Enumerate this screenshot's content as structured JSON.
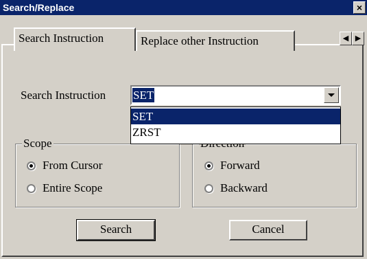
{
  "window": {
    "title": "Search/Replace",
    "close_glyph": "×"
  },
  "tabs": [
    {
      "label": "Search Instruction",
      "active": true
    },
    {
      "label": "Replace other Instruction",
      "active": false
    }
  ],
  "tab_scroll": {
    "left_icon": "left-arrow-icon",
    "right_icon": "right-arrow-icon"
  },
  "search": {
    "label": "Search Instruction",
    "value": "SET",
    "options": [
      "SET",
      "ZRST"
    ],
    "selected_index": 0
  },
  "scope": {
    "label": "Scope",
    "options": [
      {
        "label": "From Cursor",
        "checked": true
      },
      {
        "label": "Entire Scope",
        "checked": false
      }
    ]
  },
  "direction": {
    "label": "Direction",
    "options": [
      {
        "label": "Forward",
        "checked": true
      },
      {
        "label": "Backward",
        "checked": false
      }
    ]
  },
  "buttons": {
    "search": "Search",
    "cancel": "Cancel"
  },
  "colors": {
    "titlebar": "#0a246a",
    "face": "#d4d0c8",
    "selection": "#0a246a"
  }
}
